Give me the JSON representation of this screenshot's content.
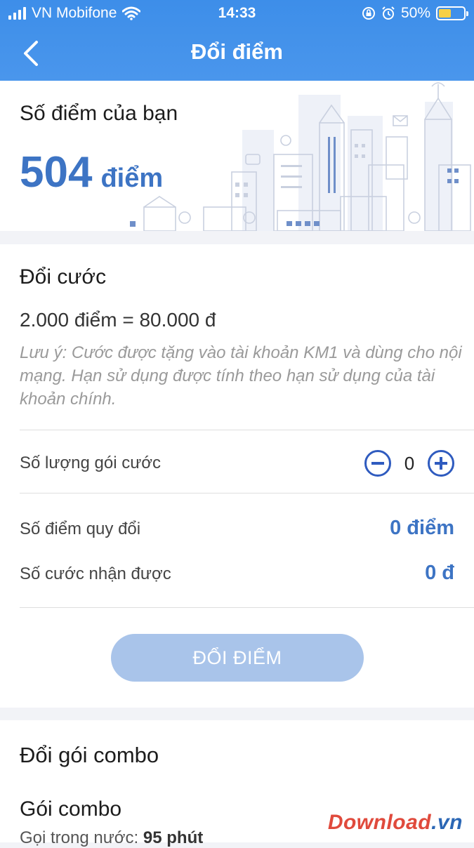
{
  "status_bar": {
    "carrier": "VN Mobifone",
    "time": "14:33",
    "battery": "50%",
    "battery_level": 0.5,
    "icons": [
      "signal-icon",
      "wifi-icon",
      "lock-rotation-icon",
      "alarm-icon",
      "battery-icon"
    ]
  },
  "nav": {
    "title": "Đổi điểm",
    "back_icon": "chevron-left-icon"
  },
  "points": {
    "label": "Số điểm của bạn",
    "value": "504",
    "unit": "điểm"
  },
  "exchange": {
    "title": "Đổi cước",
    "rate": "2.000 điểm = 80.000 đ",
    "note": "Lưu ý: Cước được tặng vào tài khoản KM1 và dùng cho nội mạng. Hạn sử dụng được tính theo hạn sử dụng của tài khoản chính.",
    "quantity_label": "Số lượng gói cước",
    "quantity": "0",
    "points_label": "Số điểm quy đổi",
    "points_value": "0 điểm",
    "credit_label": "Số cước nhận được",
    "credit_value": "0 đ",
    "button": "ĐỔI ĐIỂM"
  },
  "combo": {
    "title": "Đổi gói combo",
    "subtitle": "Gói combo",
    "line_label": "Gọi trong nước:",
    "line_value": "95 phút"
  },
  "watermark": {
    "brand": "Download",
    "tld": ".vn"
  },
  "colors": {
    "header": "#4a96ec",
    "accent": "#3d74c4",
    "button_disabled": "#a9c4ea"
  }
}
